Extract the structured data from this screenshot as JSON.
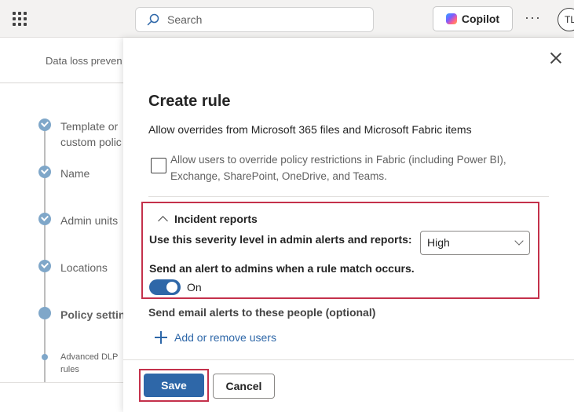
{
  "topbar": {
    "search_placeholder": "Search",
    "copilot_label": "Copilot",
    "more_label": "···",
    "avatar_initials": "TL"
  },
  "background": {
    "breadcrumb": "Data loss preven",
    "steps": [
      {
        "label": "Template or",
        "label2": "custom polic",
        "state": "complete"
      },
      {
        "label": "Name",
        "state": "complete"
      },
      {
        "label": "Admin units",
        "state": "complete"
      },
      {
        "label": "Locations",
        "state": "complete"
      },
      {
        "label": "Policy settin",
        "state": "current"
      },
      {
        "label": "Advanced DLP",
        "label2": "rules",
        "state": "substep"
      }
    ]
  },
  "panel": {
    "title": "Create rule",
    "override_heading": "Allow overrides from Microsoft 365 files and Microsoft Fabric items",
    "override_checkbox_label": "Allow users to override policy restrictions in Fabric (including Power BI), Exchange, SharePoint, OneDrive, and Teams.",
    "override_checked": false,
    "incident": {
      "heading": "Incident reports",
      "severity_label": "Use this severity level in admin alerts and reports:",
      "severity_value": "High",
      "alert_label": "Send an alert to admins when a rule match occurs.",
      "alert_toggle_state": "On",
      "alert_enabled": true
    },
    "email_label": "Send email alerts to these people (optional)",
    "add_users_label": "Add or remove users",
    "save_label": "Save",
    "cancel_label": "Cancel"
  },
  "colors": {
    "accent": "#2e67a8",
    "highlight": "#c4314b"
  }
}
